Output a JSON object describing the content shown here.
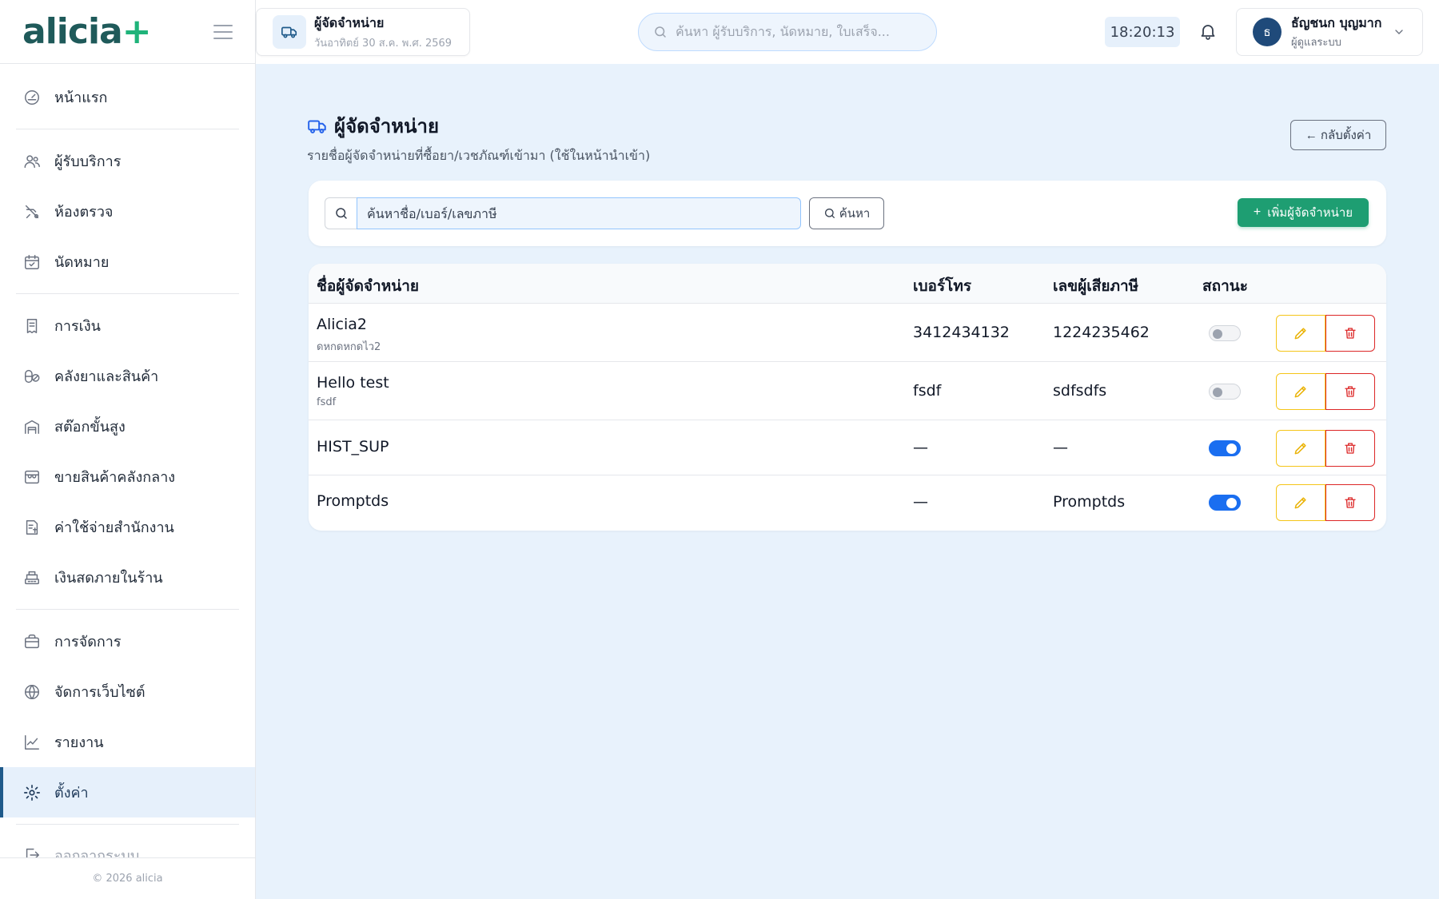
{
  "app": {
    "logo_text": "alicia",
    "logo_plus": "+"
  },
  "sidebar": {
    "items": [
      {
        "label": "หน้าแรก",
        "icon": "speedometer-icon"
      },
      {
        "label": "ผู้รับบริการ",
        "icon": "users-icon"
      },
      {
        "label": "ห้องตรวจ",
        "icon": "stethoscope-icon"
      },
      {
        "label": "นัดหมาย",
        "icon": "calendar-check-icon"
      },
      {
        "label": "การเงิน",
        "icon": "receipt-icon"
      },
      {
        "label": "คลังยาและสินค้า",
        "icon": "pills-icon"
      },
      {
        "label": "สต๊อกขั้นสูง",
        "icon": "warehouse-icon"
      },
      {
        "label": "ขายสินค้าคลังกลาง",
        "icon": "shop-icon"
      },
      {
        "label": "ค่าใช้จ่ายสำนักงาน",
        "icon": "expense-icon"
      },
      {
        "label": "เงินสดภายในร้าน",
        "icon": "cash-register-icon"
      },
      {
        "label": "การจัดการ",
        "icon": "briefcase-icon"
      },
      {
        "label": "จัดการเว็บไซต์",
        "icon": "globe-icon"
      },
      {
        "label": "รายงาน",
        "icon": "chart-line-icon"
      },
      {
        "label": "ตั้งค่า",
        "icon": "gear-icon"
      },
      {
        "label": "ออกจากระบบ",
        "icon": "logout-icon"
      }
    ],
    "active_index": 13,
    "footer": "© 2026 alicia"
  },
  "topbar": {
    "page_title": "ผู้จัดจำหน่าย",
    "page_date": "วันอาทิตย์ 30 ส.ค. พ.ศ. 2569",
    "search_placeholder": "ค้นหา ผู้รับบริการ, นัดหมาย, ใบเสร็จ...",
    "clock": "18:20:13",
    "user_initial": "ธ",
    "user_name": "ธัญชนก บุญมาก",
    "user_role": "ผู้ดูแลระบบ"
  },
  "page": {
    "title": "ผู้จัดจำหน่าย",
    "subtitle": "รายชื่อผู้จัดจำหน่ายที่ซื้อยา/เวชภัณฑ์เข้ามา (ใช้ในหน้านำเข้า)",
    "back_label": "← กลับตั้งค่า"
  },
  "filter": {
    "search_placeholder": "ค้นหาชื่อ/เบอร์/เลขภาษี",
    "search_value": "",
    "search_button": "ค้นหา",
    "add_button": "เพิ่มผู้จัดจำหน่าย"
  },
  "table": {
    "columns": [
      "ชื่อผู้จัดจำหน่าย",
      "เบอร์โทร",
      "เลขผู้เสียภาษี",
      "สถานะ"
    ],
    "rows": [
      {
        "name": "Alicia2",
        "sub": "ดหกดหกดไว2",
        "phone": "3412434132",
        "tax": "1224235462",
        "active": false
      },
      {
        "name": "Hello test",
        "sub": "fsdf",
        "phone": "fsdf",
        "tax": "sdfsdfs",
        "active": false
      },
      {
        "name": "HIST_SUP",
        "sub": "",
        "phone": "—",
        "tax": "—",
        "active": true
      },
      {
        "name": "Promptds",
        "sub": "",
        "phone": "—",
        "tax": "Promptds",
        "active": true
      }
    ]
  },
  "colors": {
    "brand": "#1f5a5a",
    "accent_green": "#1e9e72",
    "toggle_on": "#1a6ef0",
    "edit_border": "#f5c518",
    "delete_border": "#dc2626"
  }
}
